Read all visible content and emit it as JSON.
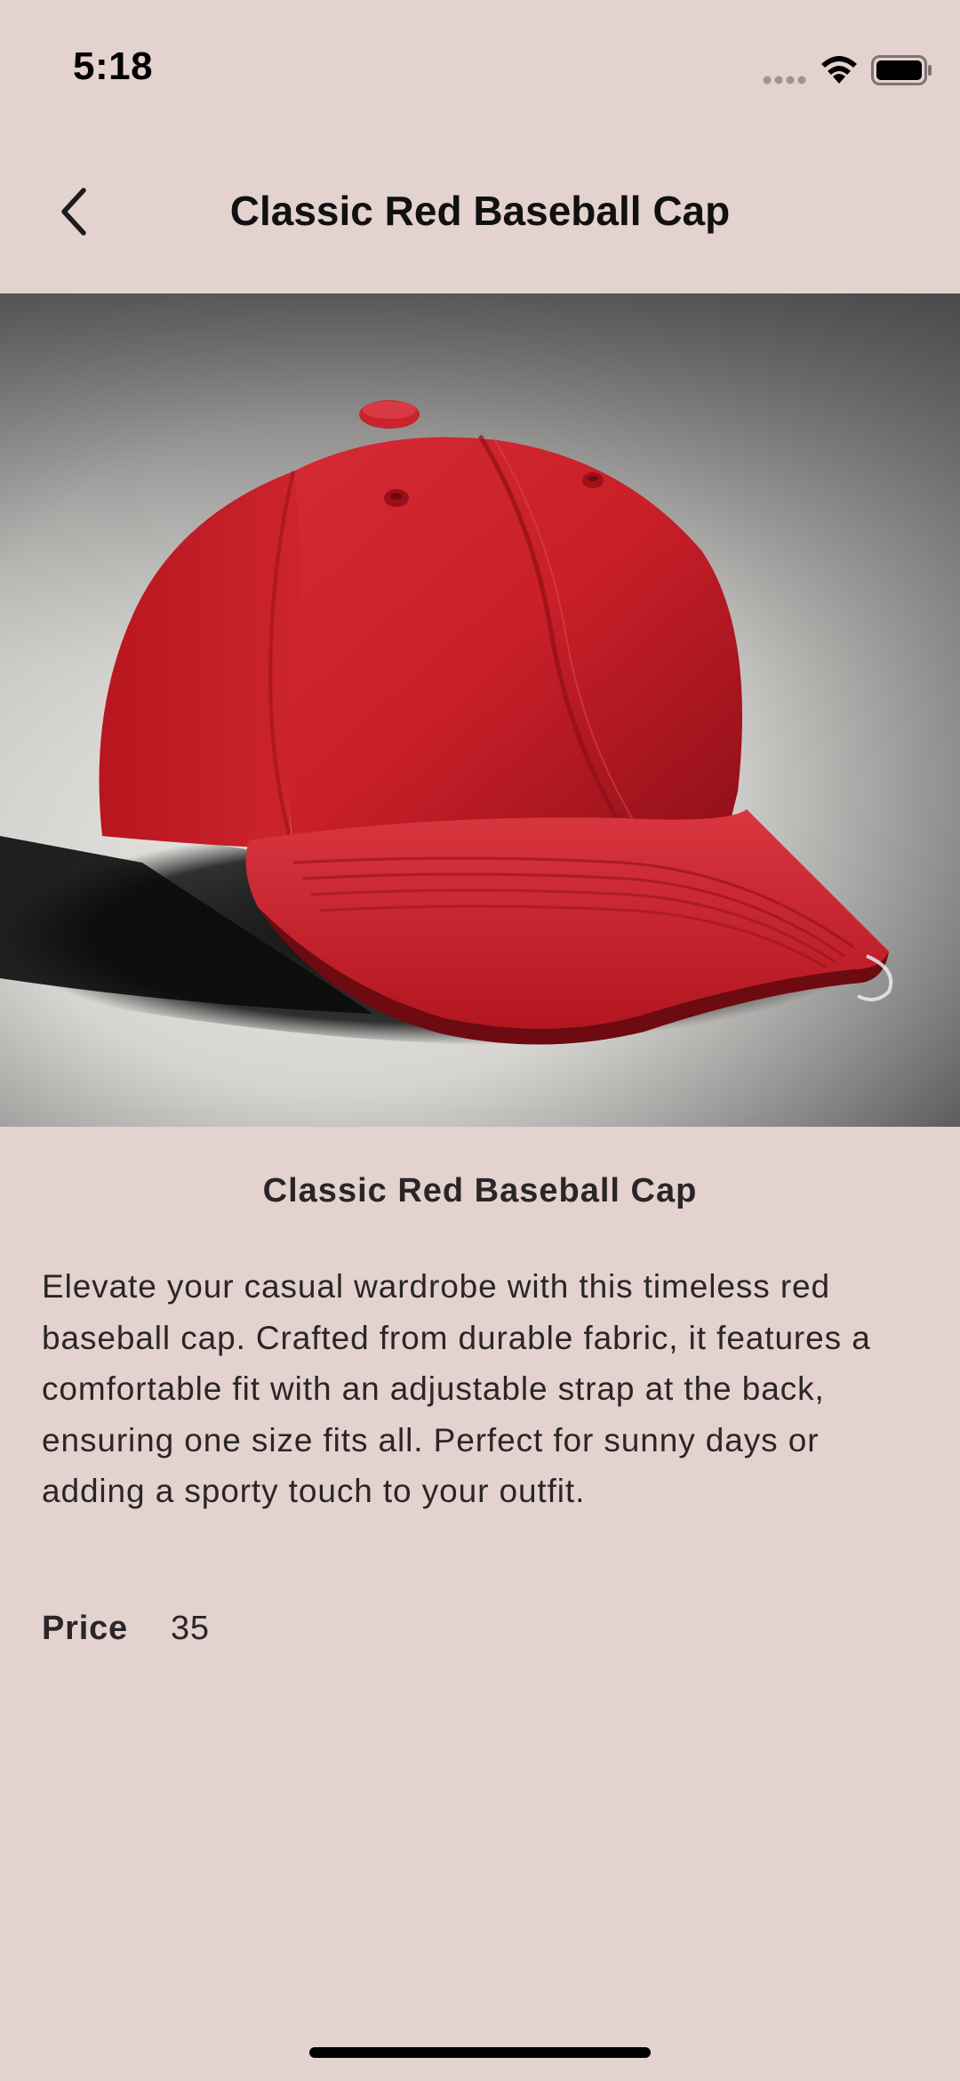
{
  "status_bar": {
    "time": "5:18"
  },
  "app_bar": {
    "title": "Classic Red Baseball Cap",
    "back_icon": "chevron-left-icon"
  },
  "product": {
    "name": "Classic Red Baseball Cap",
    "description": "Elevate your casual wardrobe with this timeless red baseball cap. Crafted from durable fabric, it features a comfortable fit with an adjustable strap at the back, ensuring one size fits all. Perfect for sunny days or adding a sporty touch to your outfit.",
    "price_label": "Price",
    "price_value": "35",
    "image_subject": "red baseball cap"
  },
  "colors": {
    "background": "#e4d2cf",
    "cap_red": "#c8202a",
    "text": "#2a2628"
  }
}
